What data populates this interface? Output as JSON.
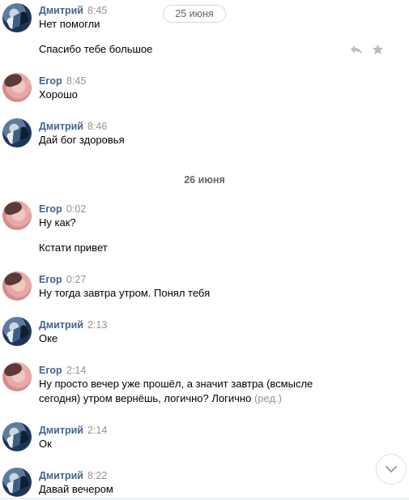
{
  "date_pill": "25 июня",
  "date_separator": "26 июня",
  "messages": [
    {
      "author": "Дмитрий",
      "time": "8:45",
      "lines": [
        "Нет помогли",
        "Спасибо тебе большое"
      ]
    },
    {
      "author": "Егор",
      "time": "8:45",
      "lines": [
        "Хорошо"
      ]
    },
    {
      "author": "Дмитрий",
      "time": "8:46",
      "lines": [
        "Дай бог здоровья"
      ]
    },
    {
      "author": "Егор",
      "time": "0:02",
      "lines": [
        "Ну как?",
        "Кстати привет"
      ]
    },
    {
      "author": "Егор",
      "time": "0:27",
      "lines": [
        "Ну тогда завтра утром. Понял тебя"
      ]
    },
    {
      "author": "Дмитрий",
      "time": "2:13",
      "lines": [
        "Оке"
      ]
    },
    {
      "author": "Егор",
      "time": "2:14",
      "lines": [
        "Ну просто вечер уже прошёл, а значит завтра (всмысле",
        "сегодня) утром вернёшь, логично? Логично"
      ],
      "edited": "(ред.)"
    },
    {
      "author": "Дмитрий",
      "time": "2:14",
      "lines": [
        "Ок"
      ]
    },
    {
      "author": "Дмитрий",
      "time": "8:22",
      "lines": [
        "Давай вечером"
      ]
    }
  ],
  "icons": {
    "reply": "reply-icon",
    "favorite": "star-icon",
    "scroll_down": "chevron-down-icon"
  },
  "colors": {
    "author": "#42648b",
    "time": "#939393"
  }
}
